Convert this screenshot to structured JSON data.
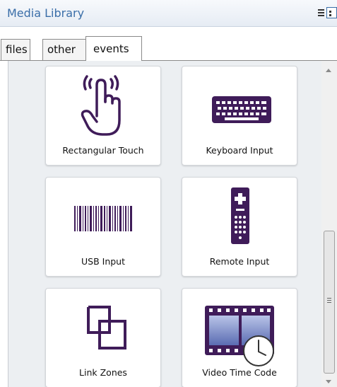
{
  "panel": {
    "title": "Media Library"
  },
  "tabs": [
    {
      "label": "files"
    },
    {
      "label": "other"
    },
    {
      "label": "events"
    }
  ],
  "active_tab": "events",
  "tiles": [
    {
      "label": "Rectangular Touch",
      "icon": "touch-hand-icon"
    },
    {
      "label": "Keyboard Input",
      "icon": "keyboard-icon"
    },
    {
      "label": "USB Input",
      "icon": "barcode-icon"
    },
    {
      "label": "Remote Input",
      "icon": "remote-control-icon"
    },
    {
      "label": "Link Zones",
      "icon": "link-zones-icon"
    },
    {
      "label": "Video Time Code",
      "icon": "video-clock-icon"
    }
  ],
  "colors": {
    "icon": "#3f1c59",
    "title": "#3a6ea8"
  }
}
